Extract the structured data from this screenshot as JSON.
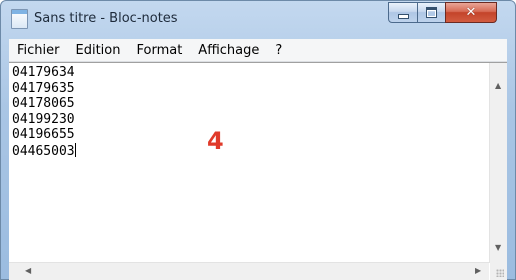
{
  "window": {
    "title": "Sans titre - Bloc-notes"
  },
  "menu": {
    "items": [
      "Fichier",
      "Edition",
      "Format",
      "Affichage",
      "?"
    ]
  },
  "editor": {
    "lines": [
      "04179634",
      "04179635",
      "04178065",
      "04199230",
      "04196655",
      "04465003"
    ]
  },
  "overlay": {
    "number": "4",
    "color": "#e03a2a"
  }
}
